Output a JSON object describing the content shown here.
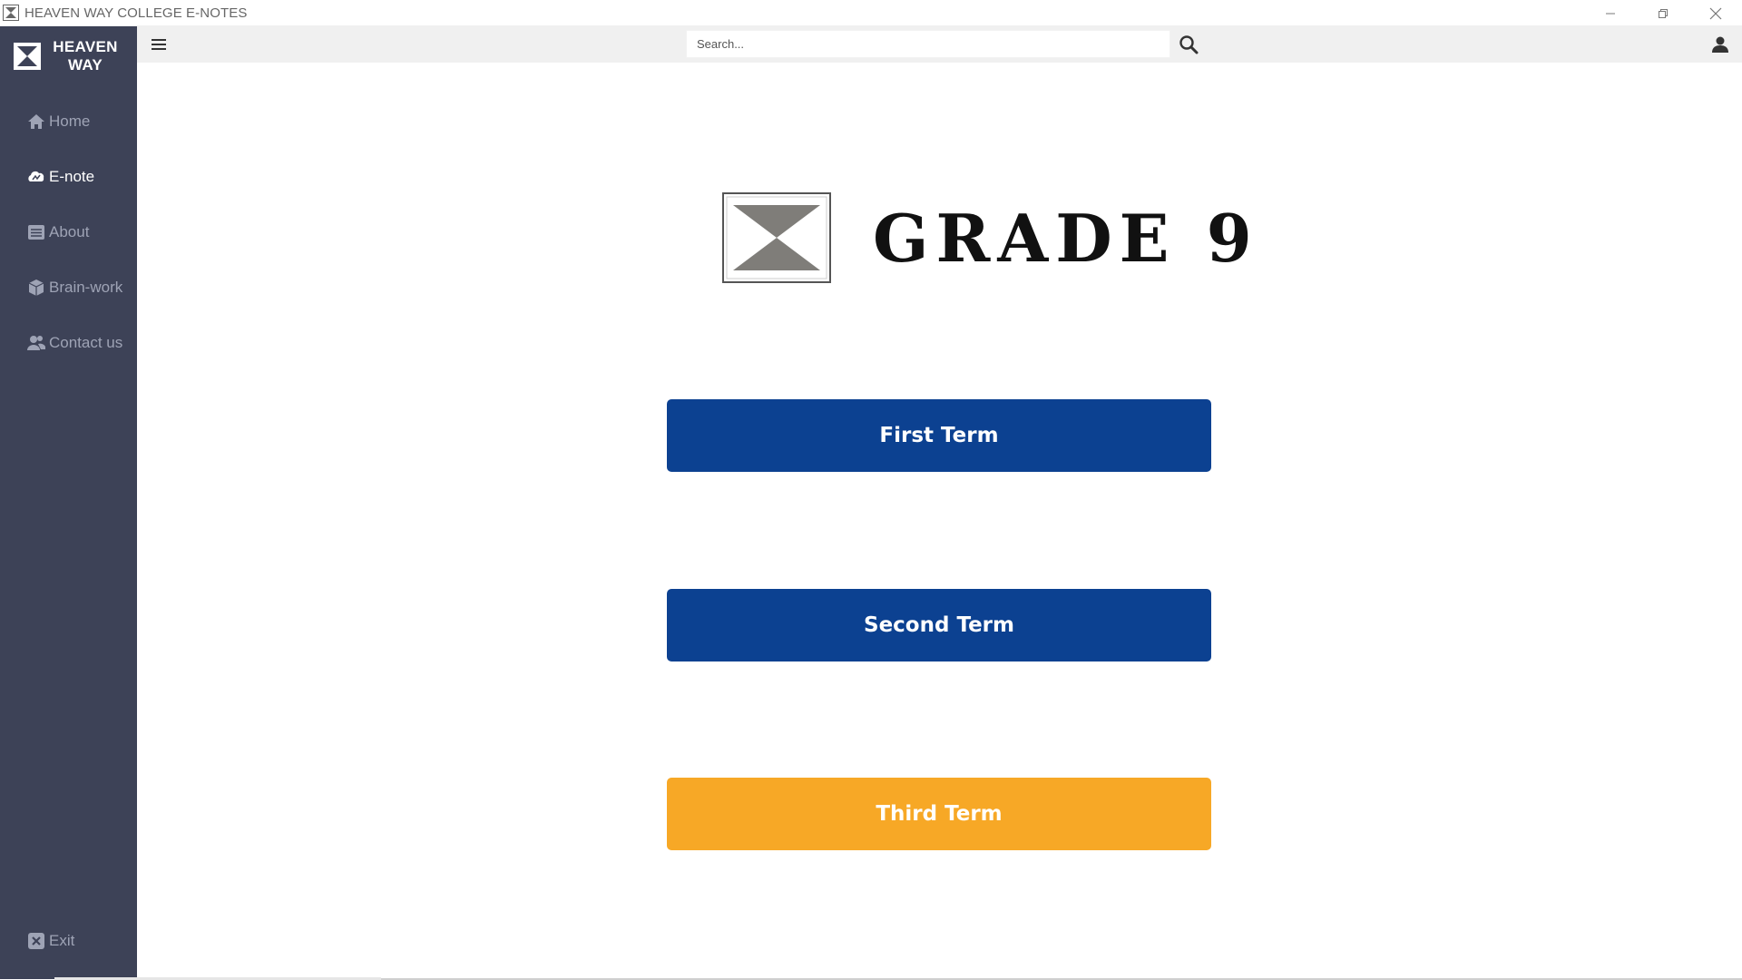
{
  "window": {
    "title": "HEAVEN WAY COLLEGE E-NOTES"
  },
  "sidebar": {
    "brand_name": "HEAVEN\nWAY",
    "items": [
      {
        "label": "Home",
        "icon": "home-icon"
      },
      {
        "label": "E-note",
        "icon": "cloud-icon",
        "active": true
      },
      {
        "label": "About",
        "icon": "list-icon"
      },
      {
        "label": "Brain-work",
        "icon": "cube-icon"
      },
      {
        "label": "Contact us",
        "icon": "users-icon"
      }
    ],
    "exit_label": "Exit"
  },
  "topbar": {
    "search_placeholder": "Search..."
  },
  "main": {
    "grade_title": "GRADE 9",
    "terms": [
      {
        "label": "First Term",
        "color": "#0c4191"
      },
      {
        "label": "Second Term",
        "color": "#0c4191"
      },
      {
        "label": "Third Term",
        "color": "#f7a826"
      }
    ]
  },
  "colors": {
    "sidebar_bg": "#3d4257",
    "topbar_bg": "#f0f0f0",
    "primary": "#0c4191",
    "accent": "#f7a826"
  }
}
